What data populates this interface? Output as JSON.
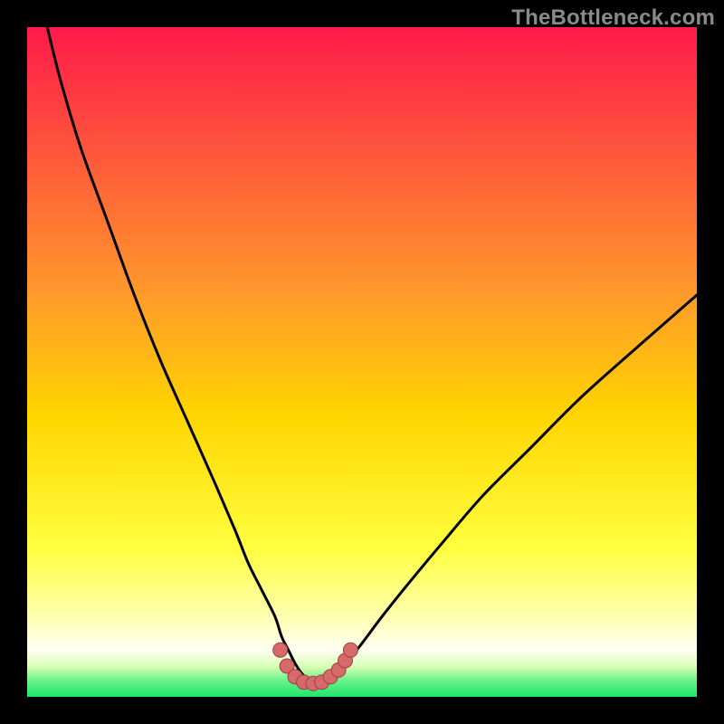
{
  "watermark": "TheBottleneck.com",
  "colors": {
    "bg_black": "#000000",
    "grad_top": "#ff1a4a",
    "grad_upper_mid": "#ff7a2a",
    "grad_mid": "#ffd500",
    "grad_lower_mid": "#ffff66",
    "grad_pale": "#ffffcc",
    "grad_green": "#1ee66a",
    "curve_stroke": "#000000",
    "dots_fill": "#d66a6a",
    "dots_stroke": "#a04040"
  },
  "chart_data": {
    "type": "line",
    "title": "",
    "xlabel": "",
    "ylabel": "",
    "xlim": [
      0,
      100
    ],
    "ylim": [
      0,
      100
    ],
    "series": [
      {
        "name": "bottleneck-curve",
        "x": [
          3,
          5,
          8,
          12,
          16,
          20,
          24,
          28,
          31,
          33,
          35,
          37,
          38,
          39,
          40,
          41,
          42,
          43,
          44,
          45,
          46,
          48,
          50,
          53,
          57,
          62,
          68,
          75,
          83,
          92,
          100
        ],
        "values": [
          100,
          92,
          82,
          71,
          60,
          50,
          41,
          32,
          25,
          20,
          16,
          12,
          9,
          7,
          5,
          3.5,
          2.5,
          2,
          2,
          2.5,
          3.5,
          5.5,
          8,
          12,
          17,
          23,
          30,
          37,
          45,
          53,
          60
        ]
      }
    ],
    "highlight_points": {
      "name": "optimal-range-dots",
      "x": [
        37.8,
        38.8,
        40.0,
        41.3,
        42.7,
        44.0,
        45.3,
        46.5,
        47.5,
        48.3
      ],
      "values": [
        7.0,
        4.6,
        3.0,
        2.2,
        2.0,
        2.2,
        3.0,
        4.0,
        5.4,
        7.0
      ]
    }
  }
}
